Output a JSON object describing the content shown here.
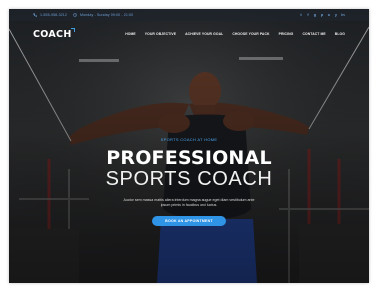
{
  "topbar": {
    "phone": "1-555-958-3212",
    "hours": "Monday - Sunday 09:00 - 21:00",
    "social_icons": [
      "twitter-icon",
      "facebook-icon",
      "google-plus-icon",
      "pinterest-icon",
      "instagram-icon",
      "youtube-icon",
      "linkedin-icon"
    ],
    "social_glyphs": [
      "t",
      "f",
      "g",
      "p",
      "o",
      "y",
      "in"
    ]
  },
  "header": {
    "logo": "COACH",
    "nav": [
      "HOME",
      "YOUR OBJECTIVE",
      "ACHIEVE YOUR GOAL",
      "CHOOSE YOUR PACK",
      "PRICING",
      "CONTACT ME",
      "BLOG"
    ]
  },
  "hero": {
    "kicker": "SPORTS COACH AT HOME",
    "headline": "PROFESSIONAL",
    "subhead": "SPORTS COACH",
    "description": "Auctor sem massa mattis aliera interdum magna augue eget diam vestibulum ante ipsum primis in faucibus orci luctus.",
    "cta": "BOOK AN APPOINTMENT"
  },
  "colors": {
    "accent": "#2f93e6",
    "topbar_text": "#6e9fd6",
    "kicker": "#4aa6ee"
  }
}
